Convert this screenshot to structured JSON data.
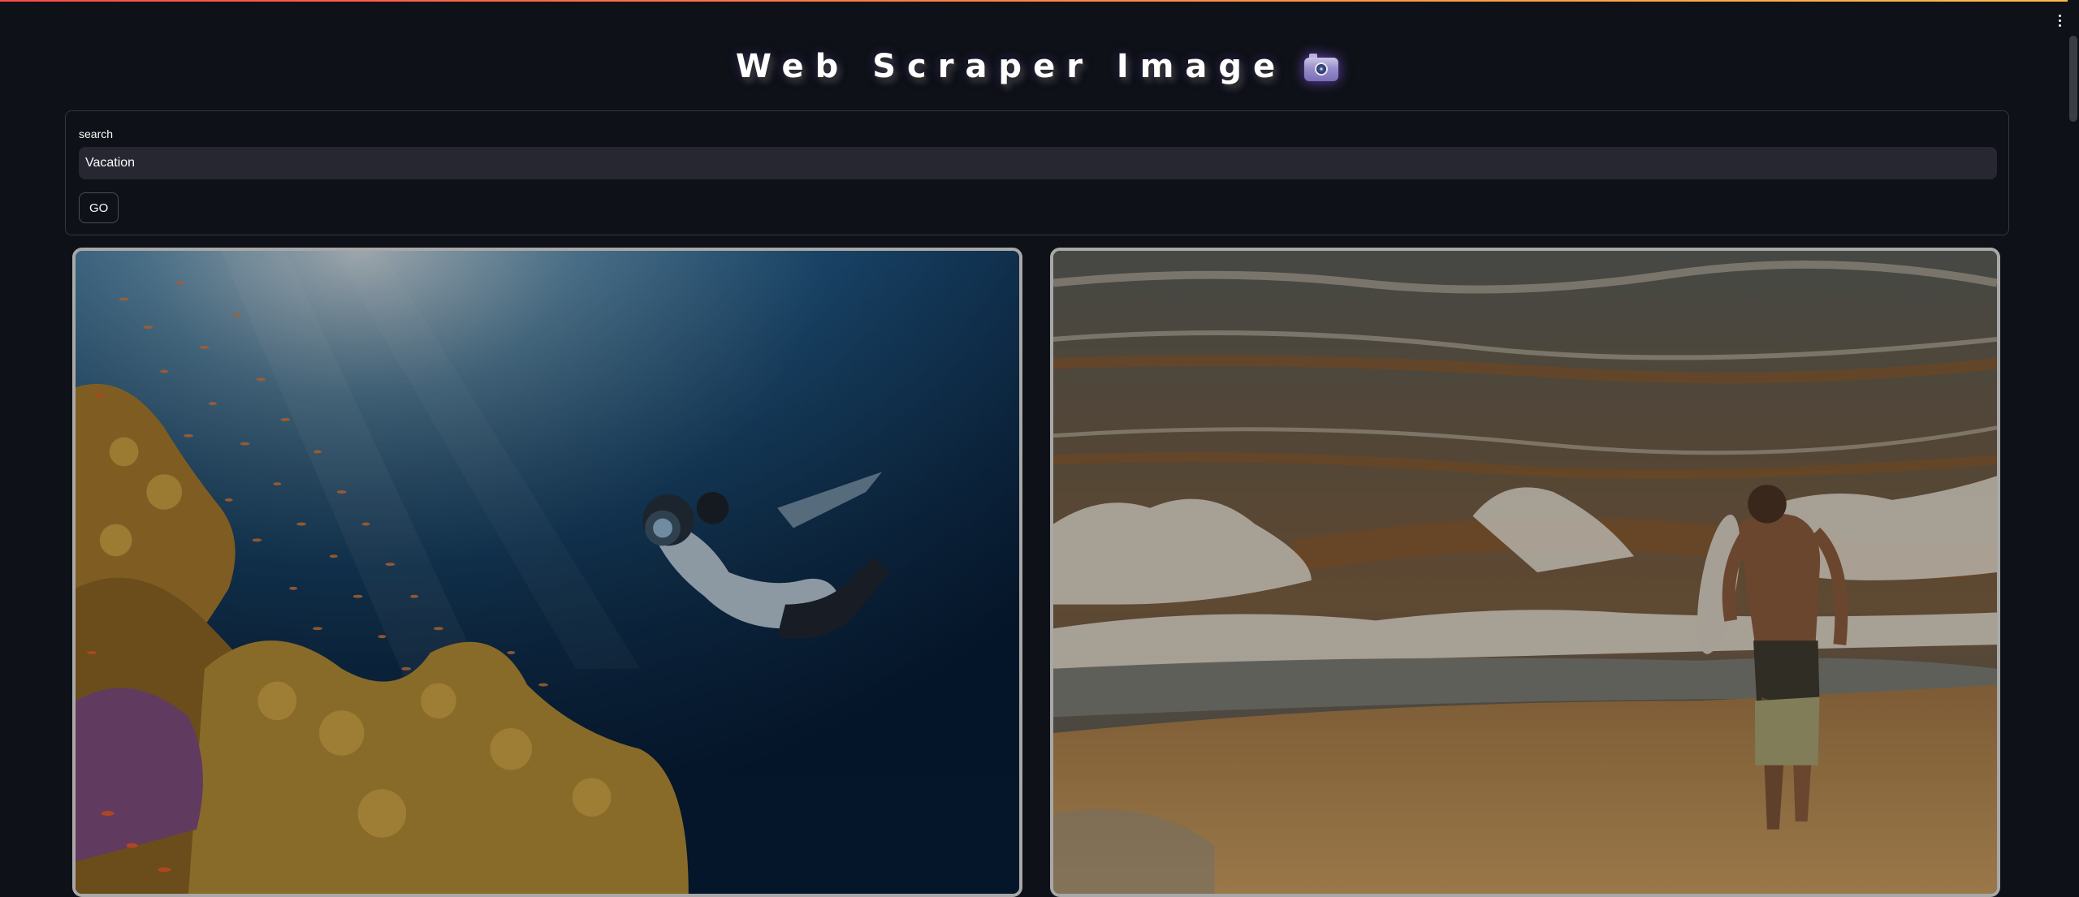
{
  "app": {
    "title": "Web Scraper Image",
    "title_icon": "camera-icon",
    "colors": {
      "background": "#0e1117",
      "input_background": "#262730",
      "accent_gradient_start": "#ff4b4b",
      "accent_gradient_end": "#ffbd45",
      "card_border": "#a8a8a8"
    }
  },
  "search": {
    "label": "search",
    "value": "Vacation",
    "button_label": "GO"
  },
  "results": {
    "images": [
      {
        "subject": "underwater-diver-coral-reef",
        "icon": "image-icon"
      },
      {
        "subject": "surfer-walking-beach-waves",
        "icon": "image-icon"
      }
    ]
  }
}
